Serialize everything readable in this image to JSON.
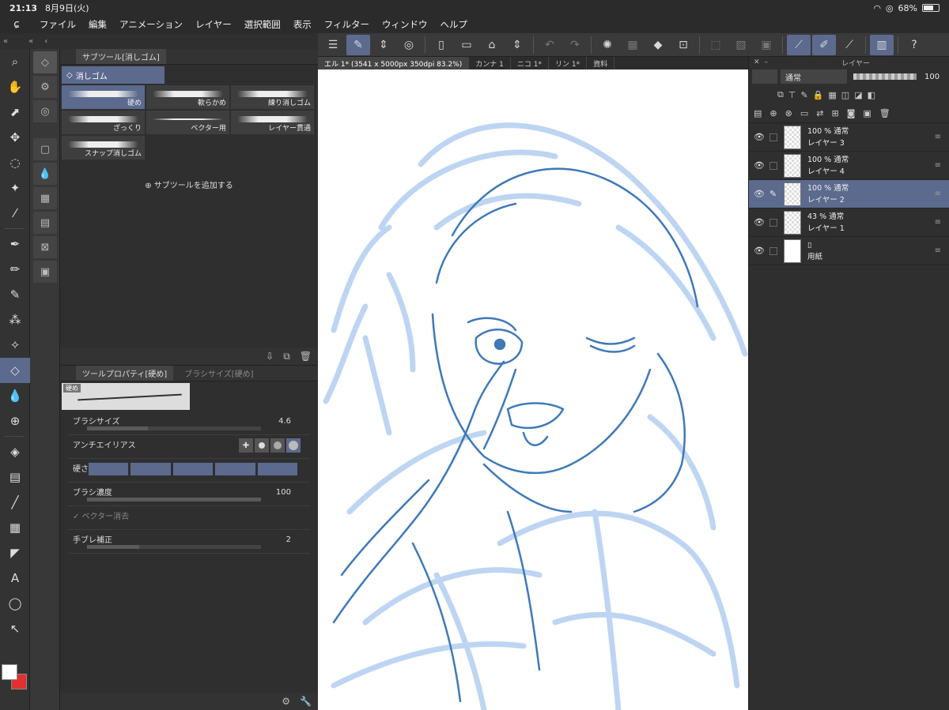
{
  "status": {
    "time": "21:13",
    "date": "8月9日(火)",
    "battery": "68%",
    "battery_level": 0.68
  },
  "menu": [
    "ファイル",
    "編集",
    "アニメーション",
    "レイヤー",
    "選択範囲",
    "表示",
    "フィルター",
    "ウィンドウ",
    "ヘルプ"
  ],
  "subtool_panel": {
    "tab": "サブツール[消しゴム]",
    "group": "消しゴム",
    "brushes": [
      "硬め",
      "軟らかめ",
      "練り消しゴム",
      "ざっくり",
      "ベクター用",
      "レイヤー貫通",
      "スナップ消しゴム"
    ],
    "add_label": "サブツールを追加する"
  },
  "tool_property": {
    "tab": "ツールプロパティ[硬め]",
    "tab2": "ブラシサイズ[硬め]",
    "preview_label": "硬め",
    "brush_size": {
      "label": "ブラシサイズ",
      "value": "4.6",
      "level": 0.35
    },
    "antialias": {
      "label": "アンチエイリアス"
    },
    "hardness": {
      "label": "硬さ"
    },
    "density": {
      "label": "ブラシ濃度",
      "value": "100",
      "level": 1.0
    },
    "vector_erase": {
      "label": "ベクター消去"
    },
    "stabilization": {
      "label": "手ブレ補正",
      "value": "2",
      "level": 0.3
    }
  },
  "doc_tabs": [
    "エル 1* (3541 x 5000px 350dpi 83.2%)",
    "カンナ 1",
    "ニコ 1*",
    "リン 1*",
    "資料"
  ],
  "layer_panel": {
    "title": "レイヤー",
    "blend_mode": "通常",
    "opacity": "100",
    "layers": [
      {
        "opacity": "100 %",
        "mode": "通常",
        "name": "レイヤー 3"
      },
      {
        "opacity": "100 %",
        "mode": "通常",
        "name": "レイヤー 4"
      },
      {
        "opacity": "100 %",
        "mode": "通常",
        "name": "レイヤー 2"
      },
      {
        "opacity": "43 %",
        "mode": "通常",
        "name": "レイヤー 1"
      },
      {
        "opacity": "",
        "mode": "",
        "name": "用紙"
      }
    ]
  },
  "colors": {
    "accent": "#5c6a8e",
    "sketch_light": "#a8c8ee",
    "sketch_dark": "#3f79b8",
    "background_color": "#e23030"
  }
}
